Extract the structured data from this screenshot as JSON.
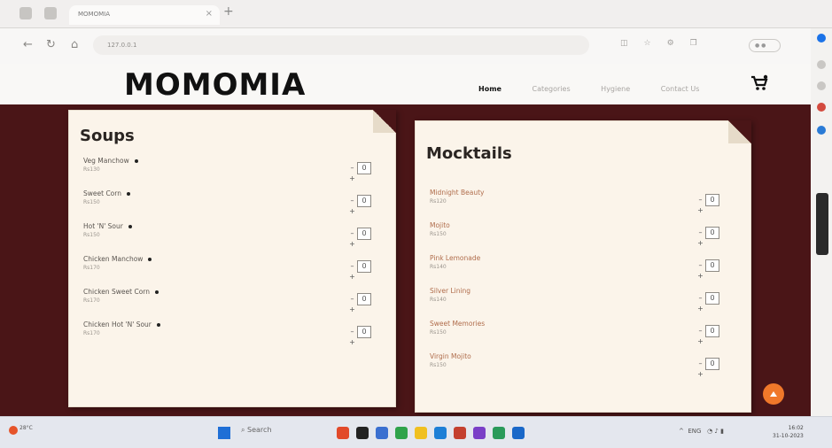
{
  "browser": {
    "tab_title": "MOMOMIA",
    "address": "127.0.0.1"
  },
  "site": {
    "logo": "MOMOMIA",
    "nav": [
      "Home",
      "Categories",
      "Hygiene",
      "Contact Us"
    ]
  },
  "menus": [
    {
      "title": "Soups",
      "items": [
        {
          "name": "Veg Manchow",
          "price": "Rs130",
          "qty": "0"
        },
        {
          "name": "Sweet Corn",
          "price": "Rs150",
          "qty": "0"
        },
        {
          "name": "Hot 'N' Sour",
          "price": "Rs150",
          "qty": "0"
        },
        {
          "name": "Chicken Manchow",
          "price": "Rs170",
          "qty": "0"
        },
        {
          "name": "Chicken Sweet Corn",
          "price": "Rs170",
          "qty": "0"
        },
        {
          "name": "Chicken Hot 'N' Sour",
          "price": "Rs170",
          "qty": "0"
        }
      ]
    },
    {
      "title": "Mocktails",
      "items": [
        {
          "name": "Midnight Beauty",
          "price": "Rs120",
          "qty": "0"
        },
        {
          "name": "Mojito",
          "price": "Rs150",
          "qty": "0"
        },
        {
          "name": "Pink Lemonade",
          "price": "Rs140",
          "qty": "0"
        },
        {
          "name": "Silver Lining",
          "price": "Rs140",
          "qty": "0"
        },
        {
          "name": "Sweet Memories",
          "price": "Rs150",
          "qty": "0"
        },
        {
          "name": "Virgin Mojito",
          "price": "Rs150",
          "qty": "0"
        }
      ]
    }
  ],
  "taskbar": {
    "weather_temp": "28°C",
    "search": "Search",
    "lang": "ENG",
    "time": "16:02",
    "date": "31-10-2023"
  },
  "colors": {
    "background": "#4a1517",
    "card": "#fbf4ea",
    "accent": "#f0782a"
  }
}
